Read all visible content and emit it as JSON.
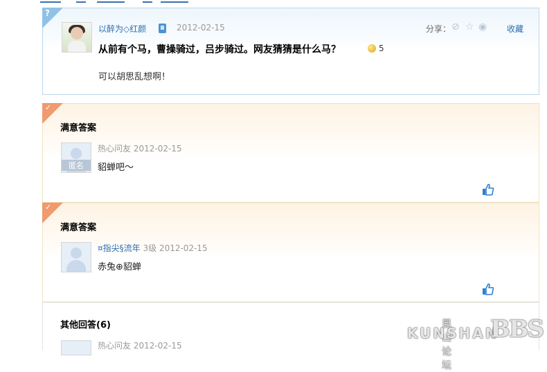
{
  "question": {
    "corner_glyph": "?",
    "user": "以醉为◇红颜",
    "date": "2012-02-15",
    "share_label": "分享：",
    "favorite": "收藏",
    "title": "从前有个马，曹操骑过，吕步骑过。网友猜猜是什么马？",
    "reward": "5",
    "body": "可以胡思乱想啊！",
    "icons": [
      "phone-icon",
      "coin-icon",
      "search-share-icon",
      "star-icon",
      "weibo-icon"
    ]
  },
  "answers": [
    {
      "heading": "满意答案",
      "avatar_label": "匿名",
      "user": "热心问友",
      "level": "",
      "date": "2012-02-15",
      "body": "貂蝉吧～"
    },
    {
      "heading": "满意答案",
      "avatar_label": "",
      "user": "¤指尖§流年",
      "level": "3级",
      "date": "2012-02-15",
      "body": "赤兔⊕貂蝉"
    }
  ],
  "others": {
    "heading": "其他回答(6)",
    "user": "热心问友",
    "date": "2012-02-15"
  },
  "watermark": {
    "cn": "昆山论坛",
    "en": "KUNSHAN",
    "bbs": "BBS"
  },
  "colors": {
    "link": "#2b6cb0",
    "question_corner": "#8ec2e6",
    "answer_corner": "#f09a6e"
  }
}
